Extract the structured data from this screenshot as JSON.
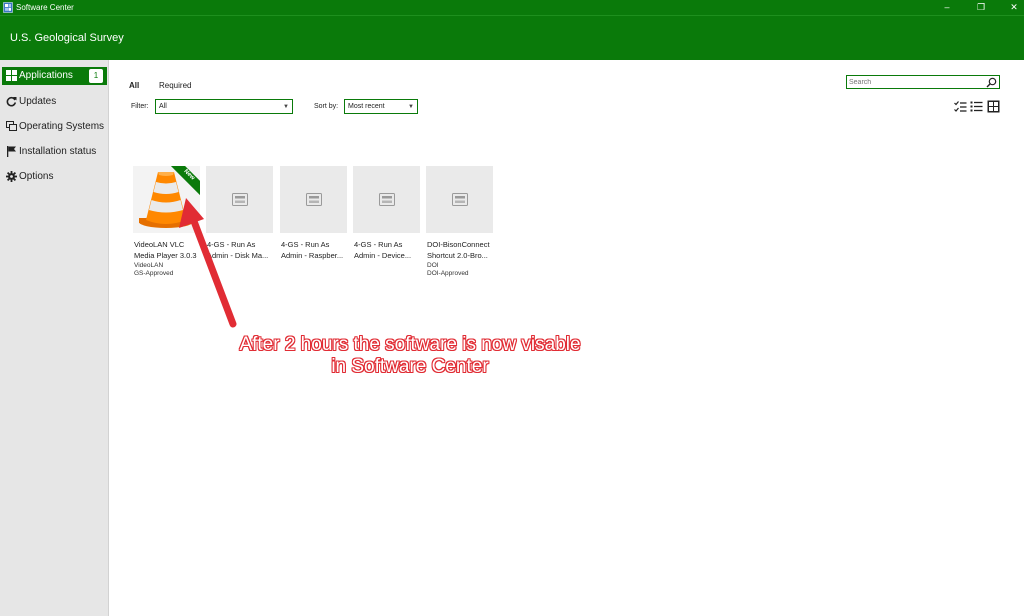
{
  "window": {
    "title": "Software Center",
    "controls": {
      "minimize": "‒",
      "maximize": "❐",
      "close": "✕"
    }
  },
  "header": {
    "organization": "U.S. Geological Survey"
  },
  "sidebar": {
    "items": [
      {
        "label": "Applications",
        "icon": "grid-icon",
        "badge": "1",
        "active": true
      },
      {
        "label": "Updates",
        "icon": "refresh-icon"
      },
      {
        "label": "Operating Systems",
        "icon": "windows-stack-icon"
      },
      {
        "label": "Installation status",
        "icon": "flag-icon"
      },
      {
        "label": "Options",
        "icon": "gear-icon"
      }
    ]
  },
  "tabs": {
    "all": "All",
    "required": "Required"
  },
  "search": {
    "placeholder": "Search",
    "value": ""
  },
  "filter": {
    "label": "Filter:",
    "value": "All"
  },
  "sort": {
    "label": "Sort by:",
    "value": "Most recent"
  },
  "cards": [
    {
      "name_line1": "VideoLAN VLC",
      "name_line2": "Media Player 3.0.3",
      "publisher": "VideoLAN",
      "status": "GS-Approved",
      "new_tag": "New",
      "icon": "vlc-cone-icon"
    },
    {
      "name_line1": "4-GS - Run As",
      "name_line2": "Admin - Disk Ma...",
      "publisher": "",
      "status": "",
      "icon": "placeholder-app-icon"
    },
    {
      "name_line1": "4-GS - Run As",
      "name_line2": "Admin - Raspber...",
      "publisher": "",
      "status": "",
      "icon": "placeholder-app-icon"
    },
    {
      "name_line1": "4-GS - Run As",
      "name_line2": "Admin - Device...",
      "publisher": "",
      "status": "",
      "icon": "placeholder-app-icon"
    },
    {
      "name_line1": "DOI-BisonConnect",
      "name_line2": "Shortcut 2.0-Bro...",
      "publisher": "DOI",
      "status": "DOI-Approved",
      "icon": "placeholder-app-icon"
    }
  ],
  "annotation": {
    "line1": "After 2 hours the software is now visable",
    "line2": "in Software Center",
    "color": "#e12c34"
  },
  "colors": {
    "accent": "#0a7a0a",
    "sidebar": "#e6e6e6"
  }
}
